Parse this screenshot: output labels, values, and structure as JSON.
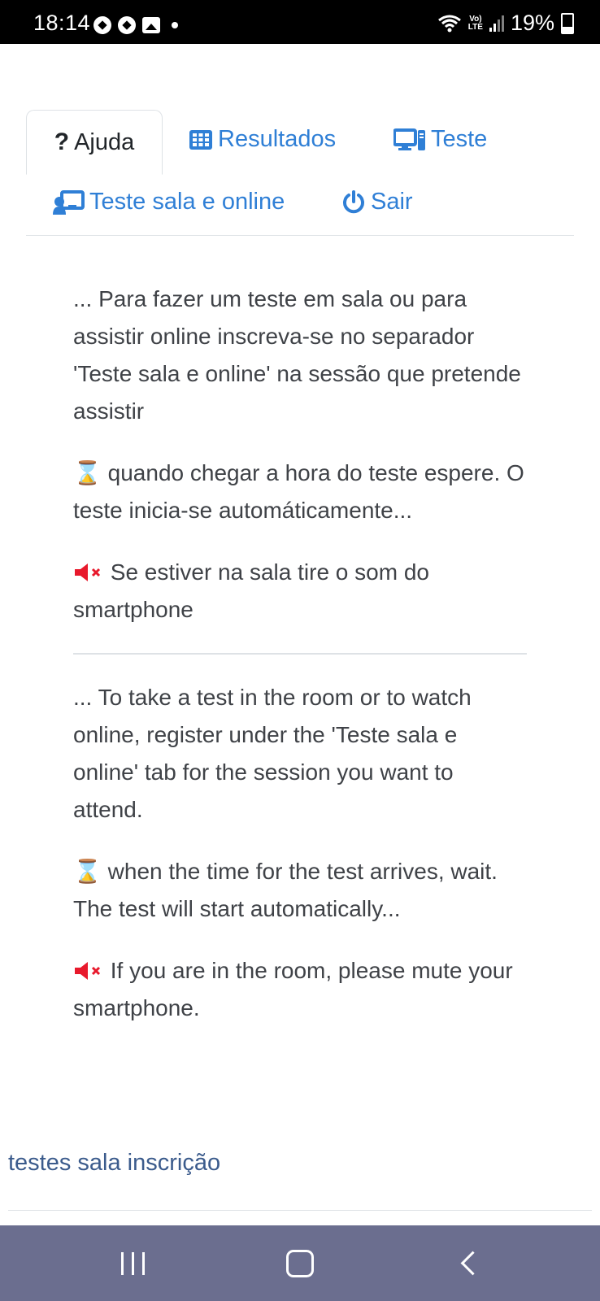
{
  "status_bar": {
    "time": "18:14",
    "battery": "19%",
    "network_top": "Vo)",
    "network_bottom": "LTE"
  },
  "tabs": [
    {
      "icon": "?",
      "label": "Ajuda",
      "active": true
    },
    {
      "icon": "▦",
      "label": "Resultados",
      "active": false
    },
    {
      "icon": "🖥",
      "label": "Teste",
      "active": false
    },
    {
      "icon": "👨‍🏫",
      "label": "Teste sala e online",
      "active": false
    },
    {
      "icon": "⏻",
      "label": "Sair",
      "active": false
    }
  ],
  "help": {
    "pt_intro": "... Para fazer um teste em sala ou para assistir online inscreva-se no separador 'Teste sala e online' na sessão que pretende assistir",
    "pt_wait": "quando chegar a hora do teste espere. O teste inicia-se automáticamente...",
    "pt_mute": "Se estiver na sala tire o som do smartphone",
    "en_intro": "... To take a test in the room or to watch online, register under the 'Teste sala e online' tab for the session you want to attend.",
    "en_wait": "when the time for the test arrives, wait. The test will start automatically...",
    "en_mute": "If you are in the room, please mute your smartphone."
  },
  "footer": {
    "link": "testes sala inscrição"
  },
  "colors": {
    "accent": "#2f7fd6",
    "warning_icon": "#e8192c",
    "nav_bar": "#6b6e8f"
  }
}
